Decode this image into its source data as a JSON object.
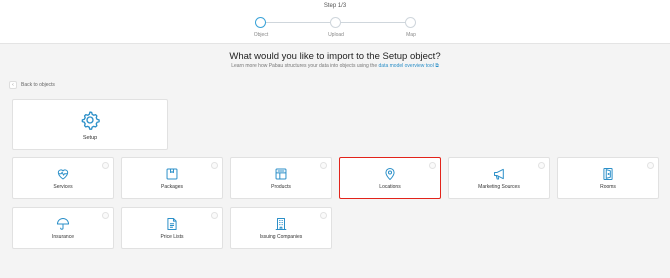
{
  "stepper": {
    "title": "Step 1/3",
    "steps": [
      {
        "label": "Object",
        "active": true
      },
      {
        "label": "Upload",
        "active": false
      },
      {
        "label": "Map",
        "active": false
      }
    ]
  },
  "heading": "What would you like to import to the Setup object?",
  "subheading": {
    "text": "Learn more how Pabau structures your data into objects using the ",
    "link": "data model overview tool ⧉"
  },
  "back_label": "Back to objects",
  "setup_card": {
    "label": "Setup",
    "icon": "gear-icon"
  },
  "cards": [
    {
      "label": "Services",
      "icon": "heart-pulse-icon",
      "selected": false
    },
    {
      "label": "Packages",
      "icon": "package-icon",
      "selected": false
    },
    {
      "label": "Products",
      "icon": "products-icon",
      "selected": false
    },
    {
      "label": "Locations",
      "icon": "location-pin-icon",
      "selected": true
    },
    {
      "label": "Marketing Sources",
      "icon": "megaphone-icon",
      "selected": false
    },
    {
      "label": "Rooms",
      "icon": "door-icon",
      "selected": false
    },
    {
      "label": "Insurance",
      "icon": "umbrella-icon",
      "selected": false
    },
    {
      "label": "Price Lists",
      "icon": "document-icon",
      "selected": false
    },
    {
      "label": "Issuing Companies",
      "icon": "building-icon",
      "selected": false
    }
  ],
  "colors": {
    "accent": "#3aa3d8",
    "selected_border": "#e2231a"
  }
}
